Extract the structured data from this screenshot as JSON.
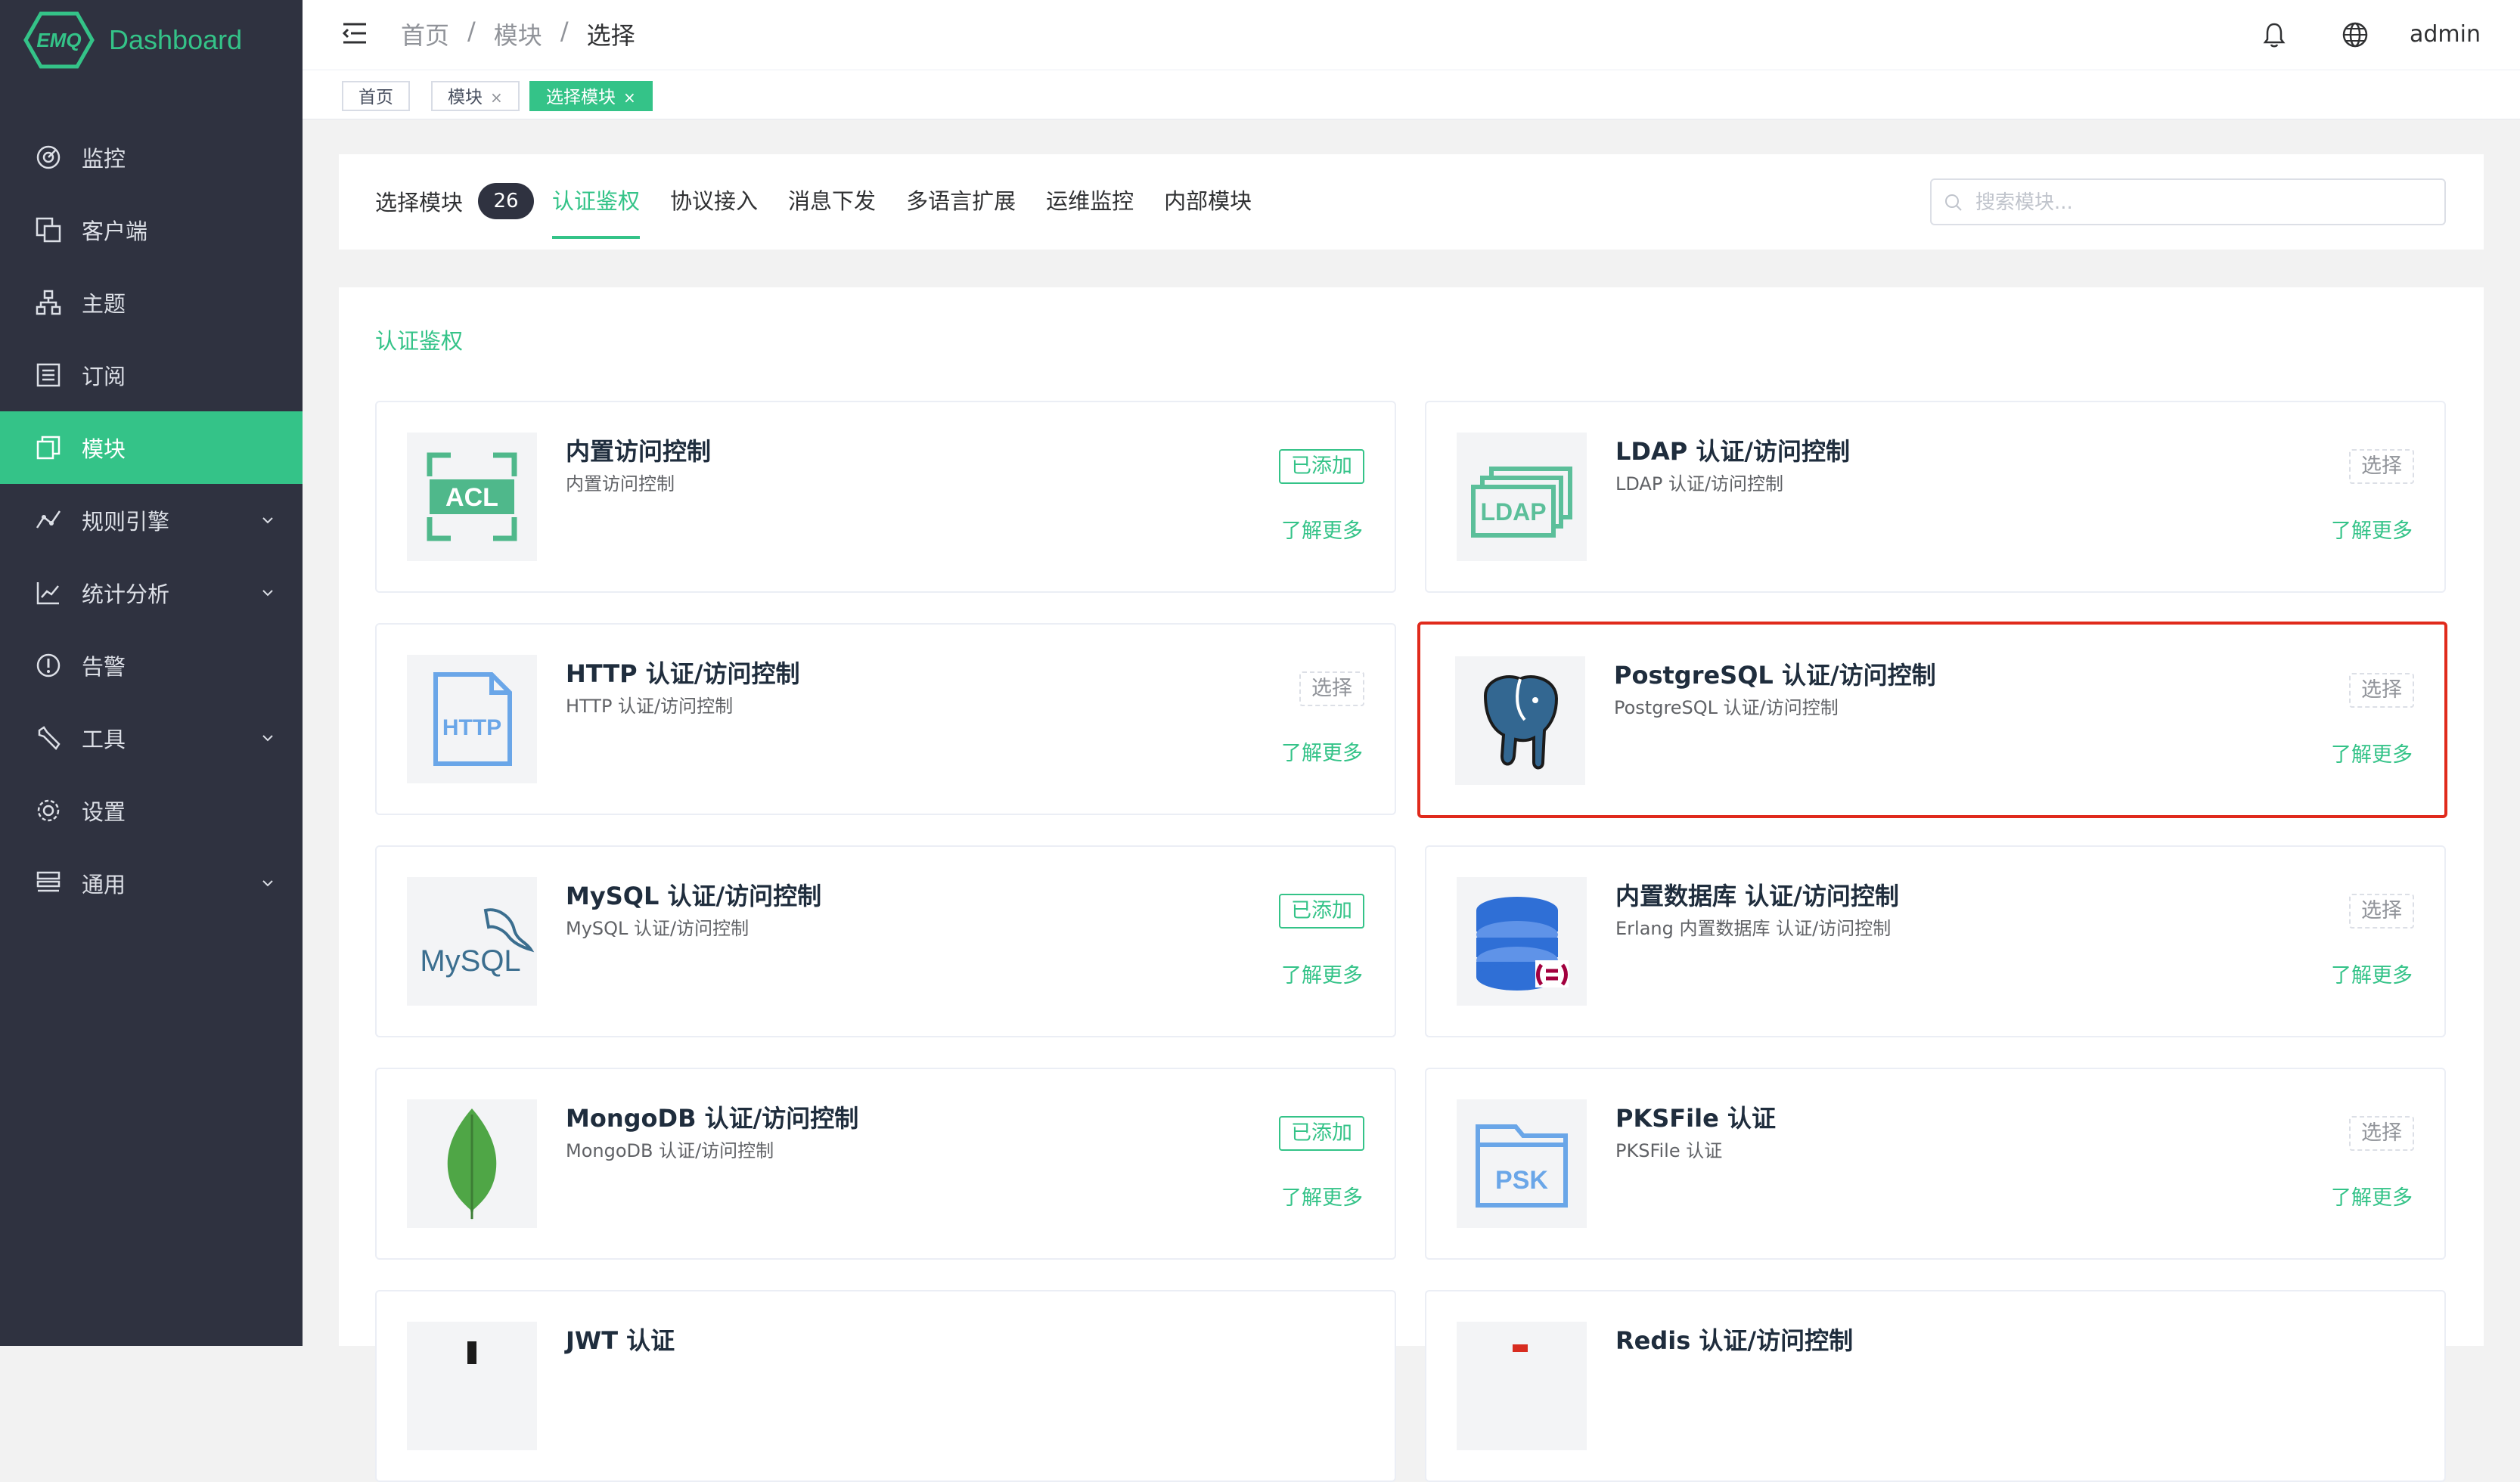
{
  "sidebar": {
    "brand": {
      "logo_text": "EMQ",
      "title": "Dashboard"
    },
    "items": [
      {
        "label": "监控",
        "icon": "monitor-icon",
        "active": false,
        "has_submenu": false
      },
      {
        "label": "客户端",
        "icon": "clients-icon",
        "active": false,
        "has_submenu": false
      },
      {
        "label": "主题",
        "icon": "topics-icon",
        "active": false,
        "has_submenu": false
      },
      {
        "label": "订阅",
        "icon": "subscriptions-icon",
        "active": false,
        "has_submenu": false
      },
      {
        "label": "模块",
        "icon": "modules-icon",
        "active": true,
        "has_submenu": false
      },
      {
        "label": "规则引擎",
        "icon": "rule-engine-icon",
        "active": false,
        "has_submenu": true
      },
      {
        "label": "统计分析",
        "icon": "analytics-icon",
        "active": false,
        "has_submenu": true
      },
      {
        "label": "告警",
        "icon": "alarm-icon",
        "active": false,
        "has_submenu": false
      },
      {
        "label": "工具",
        "icon": "tools-icon",
        "active": false,
        "has_submenu": true
      },
      {
        "label": "设置",
        "icon": "settings-icon",
        "active": false,
        "has_submenu": false
      },
      {
        "label": "通用",
        "icon": "general-icon",
        "active": false,
        "has_submenu": true
      }
    ]
  },
  "header": {
    "breadcrumb": [
      "首页",
      "模块",
      "选择"
    ],
    "separator": "/",
    "user": "admin"
  },
  "tags": [
    {
      "label": "首页",
      "closable": false,
      "active": false
    },
    {
      "label": "模块",
      "closable": true,
      "active": false
    },
    {
      "label": "选择模块",
      "closable": true,
      "active": true
    }
  ],
  "toolbar": {
    "title": "选择模块",
    "count": "26",
    "tabs": [
      "认证鉴权",
      "协议接入",
      "消息下发",
      "多语言扩展",
      "运维监控",
      "内部模块"
    ],
    "active_tab": "认证鉴权",
    "search_placeholder": "搜索模块..."
  },
  "section": {
    "title": "认证鉴权"
  },
  "learn_more": "了解更多",
  "cards": [
    {
      "title": "内置访问控制",
      "desc": "内置访问控制",
      "button": "已添加",
      "state": "added",
      "icon": "acl-icon",
      "icon_text": "ACL"
    },
    {
      "title": "LDAP 认证/访问控制",
      "desc": "LDAP 认证/访问控制",
      "button": "选择",
      "state": "choose",
      "icon": "ldap-icon",
      "icon_text": "LDAP"
    },
    {
      "title": "HTTP 认证/访问控制",
      "desc": "HTTP 认证/访问控制",
      "button": "选择",
      "state": "choose",
      "icon": "http-file-icon",
      "icon_text": "HTTP"
    },
    {
      "title": "PostgreSQL 认证/访问控制",
      "desc": "PostgreSQL 认证/访问控制",
      "button": "选择",
      "state": "choose",
      "icon": "postgresql-elephant-icon",
      "icon_text": ""
    },
    {
      "title": "MySQL 认证/访问控制",
      "desc": "MySQL 认证/访问控制",
      "button": "已添加",
      "state": "added",
      "icon": "mysql-dolphin-icon",
      "icon_text": "MySQL"
    },
    {
      "title": "内置数据库 认证/访问控制",
      "desc": "Erlang 内置数据库 认证/访问控制",
      "button": "选择",
      "state": "choose",
      "icon": "database-icon",
      "icon_text": ""
    },
    {
      "title": "MongoDB 认证/访问控制",
      "desc": "MongoDB 认证/访问控制",
      "button": "已添加",
      "state": "added",
      "icon": "mongodb-leaf-icon",
      "icon_text": ""
    },
    {
      "title": "PKSFile 认证",
      "desc": "PKSFile 认证",
      "button": "选择",
      "state": "choose",
      "icon": "psk-folder-icon",
      "icon_text": "PSK"
    },
    {
      "title": "JWT 认证",
      "desc": "",
      "button": "",
      "state": "choose",
      "icon": "jwt-icon",
      "icon_text": ""
    },
    {
      "title": "Redis 认证/访问控制",
      "desc": "",
      "button": "",
      "state": "choose",
      "icon": "redis-icon",
      "icon_text": ""
    }
  ],
  "colors": {
    "brand_green": "#34c388",
    "sidebar_bg": "#2f3240",
    "highlight_border": "#e02a1c"
  }
}
